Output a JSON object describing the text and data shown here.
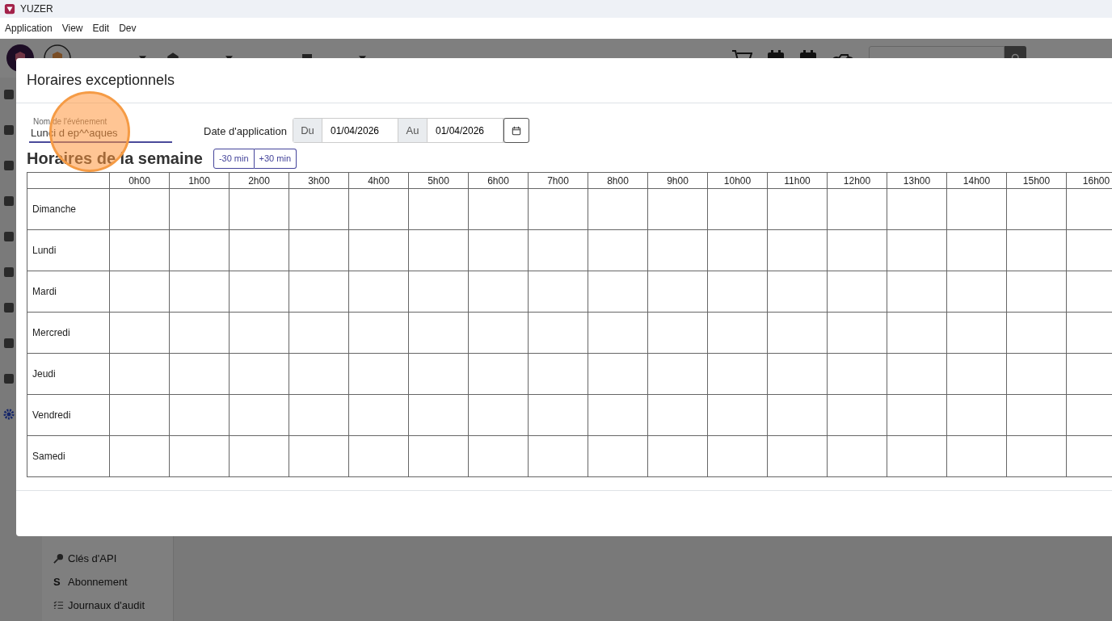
{
  "window": {
    "title": "YUZER"
  },
  "menu": [
    "Application",
    "View",
    "Edit",
    "Dev"
  ],
  "sidebar": {
    "items": [
      {
        "kind": "key",
        "label": "Clés d'API"
      },
      {
        "kind": "glyph",
        "glyph": "S",
        "label": "Abonnement"
      },
      {
        "kind": "checklist",
        "label": "Journaux d'audit"
      }
    ]
  },
  "dialog": {
    "title": "Horaires exceptionnels",
    "event_name": {
      "label": "Nom de l'événement",
      "value": "Lunci d ep^^aques"
    },
    "date": {
      "label": "Date d'application",
      "from_label": "Du",
      "from": "01/04/2026",
      "to_label": "Au",
      "to": "01/04/2026"
    },
    "week": {
      "heading": "Horaires de la semaine",
      "buttons": [
        "-30 min",
        "+30 min"
      ]
    },
    "table": {
      "columns": [
        "0h00",
        "1h00",
        "2h00",
        "3h00",
        "4h00",
        "5h00",
        "6h00",
        "7h00",
        "8h00",
        "9h00",
        "10h00",
        "11h00",
        "12h00",
        "13h00",
        "14h00",
        "15h00",
        "16h00"
      ],
      "rows": [
        "Dimanche",
        "Lundi",
        "Mardi",
        "Mercredi",
        "Jeudi",
        "Vendredi",
        "Samedi"
      ]
    }
  }
}
